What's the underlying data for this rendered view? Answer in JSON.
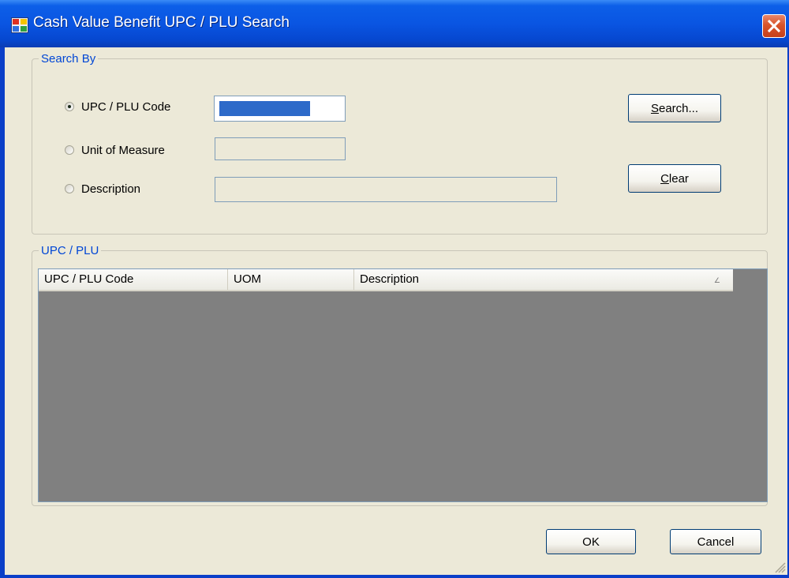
{
  "window": {
    "title": "Cash Value Benefit UPC / PLU Search"
  },
  "search_by": {
    "legend": "Search By",
    "options": [
      {
        "label": "UPC / PLU Code",
        "checked": true
      },
      {
        "label": "Unit of Measure",
        "checked": false
      },
      {
        "label": "Description",
        "checked": false
      }
    ],
    "search_button": {
      "label_u": "S",
      "label_rest": "earch..."
    },
    "clear_button": {
      "label_u": "C",
      "label_rest": "lear"
    }
  },
  "results": {
    "legend": "UPC / PLU",
    "columns": [
      "UPC / PLU Code",
      "UOM",
      "Description"
    ],
    "sort_glyph": "∠"
  },
  "footer": {
    "ok": "OK",
    "cancel": "Cancel"
  },
  "colors": {
    "titlebar": "#0a55e2",
    "accent_text": "#0046d5",
    "client_bg": "#ece9d8",
    "list_bg": "#808080"
  },
  "icons": {
    "app": "app-window-icon",
    "close": "close-icon",
    "resize": "resize-grip-icon"
  }
}
